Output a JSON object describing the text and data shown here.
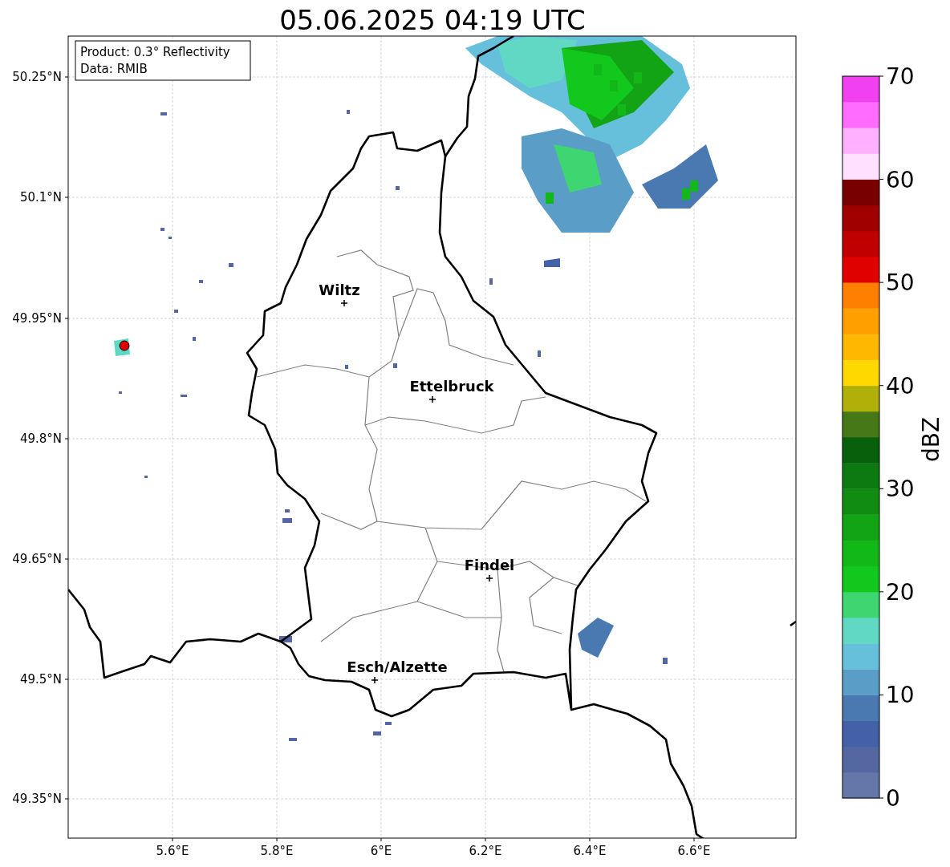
{
  "title": "05.06.2025 04:19 UTC",
  "info_box": [
    "Product: 0.3° Reflectivity",
    "Data: RMIB"
  ],
  "cities": [
    {
      "name": "Wiltz"
    },
    {
      "name": "Ettelbruck"
    },
    {
      "name": "Findel"
    },
    {
      "name": "Esch/Alzette"
    }
  ],
  "y_ticks": [
    "50.25°N",
    "50.1°N",
    "49.95°N",
    "49.8°N",
    "49.65°N",
    "49.5°N",
    "49.35°N"
  ],
  "x_ticks": [
    "5.6°E",
    "5.8°E",
    "6°E",
    "6.2°E",
    "6.4°E",
    "6.6°E"
  ],
  "colorbar": {
    "label": "dBZ",
    "ticks": [
      "70",
      "60",
      "50",
      "40",
      "30",
      "20",
      "10",
      "0"
    ],
    "segments": [
      {
        "color": "#6477a8"
      },
      {
        "color": "#5467a0"
      },
      {
        "color": "#4460a6"
      },
      {
        "color": "#4a78b0"
      },
      {
        "color": "#5a9ec8"
      },
      {
        "color": "#66c0dc"
      },
      {
        "color": "#60d8c4"
      },
      {
        "color": "#3dd670"
      },
      {
        "color": "#12c81c"
      },
      {
        "color": "#12b818"
      },
      {
        "color": "#12a414"
      },
      {
        "color": "#108c12"
      },
      {
        "color": "#0c7a10"
      },
      {
        "color": "#08600c"
      },
      {
        "color": "#467818"
      },
      {
        "color": "#b0b008"
      },
      {
        "color": "#ffd800"
      },
      {
        "color": "#ffb800"
      },
      {
        "color": "#ffa000"
      },
      {
        "color": "#ff8000"
      },
      {
        "color": "#e00000"
      },
      {
        "color": "#c00000"
      },
      {
        "color": "#a00000"
      },
      {
        "color": "#780000"
      },
      {
        "color": "#ffe0ff"
      },
      {
        "color": "#ffb0ff"
      },
      {
        "color": "#ff6cff"
      },
      {
        "color": "#f040f0"
      }
    ]
  }
}
